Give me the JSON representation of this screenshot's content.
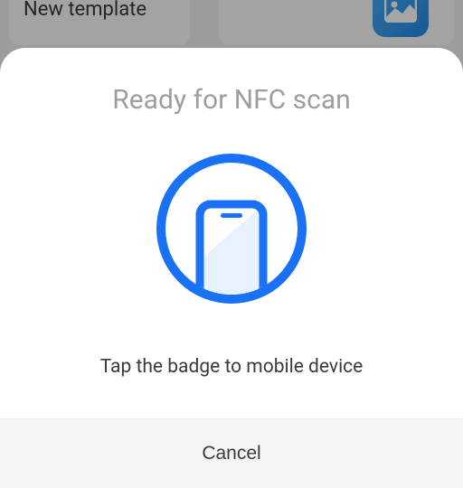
{
  "background": {
    "card_label": "New template",
    "icon_name": "image-icon"
  },
  "modal": {
    "title": "Ready for NFC scan",
    "instruction": "Tap the badge to mobile device",
    "cancel_label": "Cancel",
    "illustration": "phone-in-circle-icon",
    "accent_color": "#1971f5"
  }
}
